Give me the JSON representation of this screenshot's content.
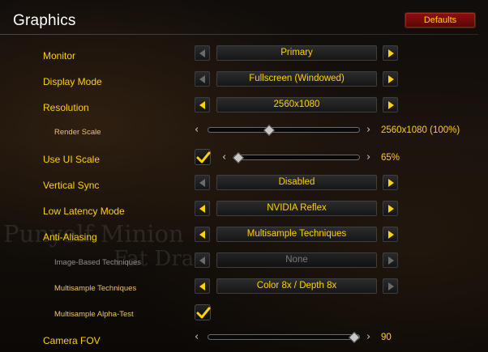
{
  "header": {
    "title": "Graphics",
    "defaults_label": "Defaults"
  },
  "background_text": {
    "line1": "Punyelf Minion",
    "line2": "Fat Dra"
  },
  "settings": {
    "monitor": {
      "label": "Monitor",
      "value": "Primary"
    },
    "display_mode": {
      "label": "Display Mode",
      "value": "Fullscreen (Windowed)"
    },
    "resolution": {
      "label": "Resolution",
      "value": "2560x1080"
    },
    "render_scale": {
      "label": "Render Scale",
      "value_text": "2560x1080 (100%)",
      "level_fraction": 0.45
    },
    "use_ui_scale": {
      "label": "Use UI Scale",
      "checked": true,
      "value_text": "65%",
      "level_fraction": 0.0
    },
    "vertical_sync": {
      "label": "Vertical Sync",
      "value": "Disabled"
    },
    "low_latency_mode": {
      "label": "Low Latency Mode",
      "value": "NVIDIA Reflex"
    },
    "anti_aliasing": {
      "label": "Anti-Aliasing",
      "value": "Multisample Techniques"
    },
    "image_based_techniques": {
      "label": "Image-Based Techniques",
      "value": "None",
      "disabled": true
    },
    "multisample_techniques": {
      "label": "Multisample Techniques",
      "value": "Color 8x / Depth 8x"
    },
    "multisample_alpha_test": {
      "label": "Multisample Alpha-Test",
      "checked": true
    },
    "camera_fov": {
      "label": "Camera FOV",
      "value_text": "90",
      "level_fraction": 0.95
    }
  },
  "colors": {
    "label": "#ffd200",
    "accent_button": "#7a0a0a"
  },
  "icons": {
    "prev": "triangle-left-icon",
    "next": "triangle-right-icon",
    "check": "checkmark-icon"
  }
}
